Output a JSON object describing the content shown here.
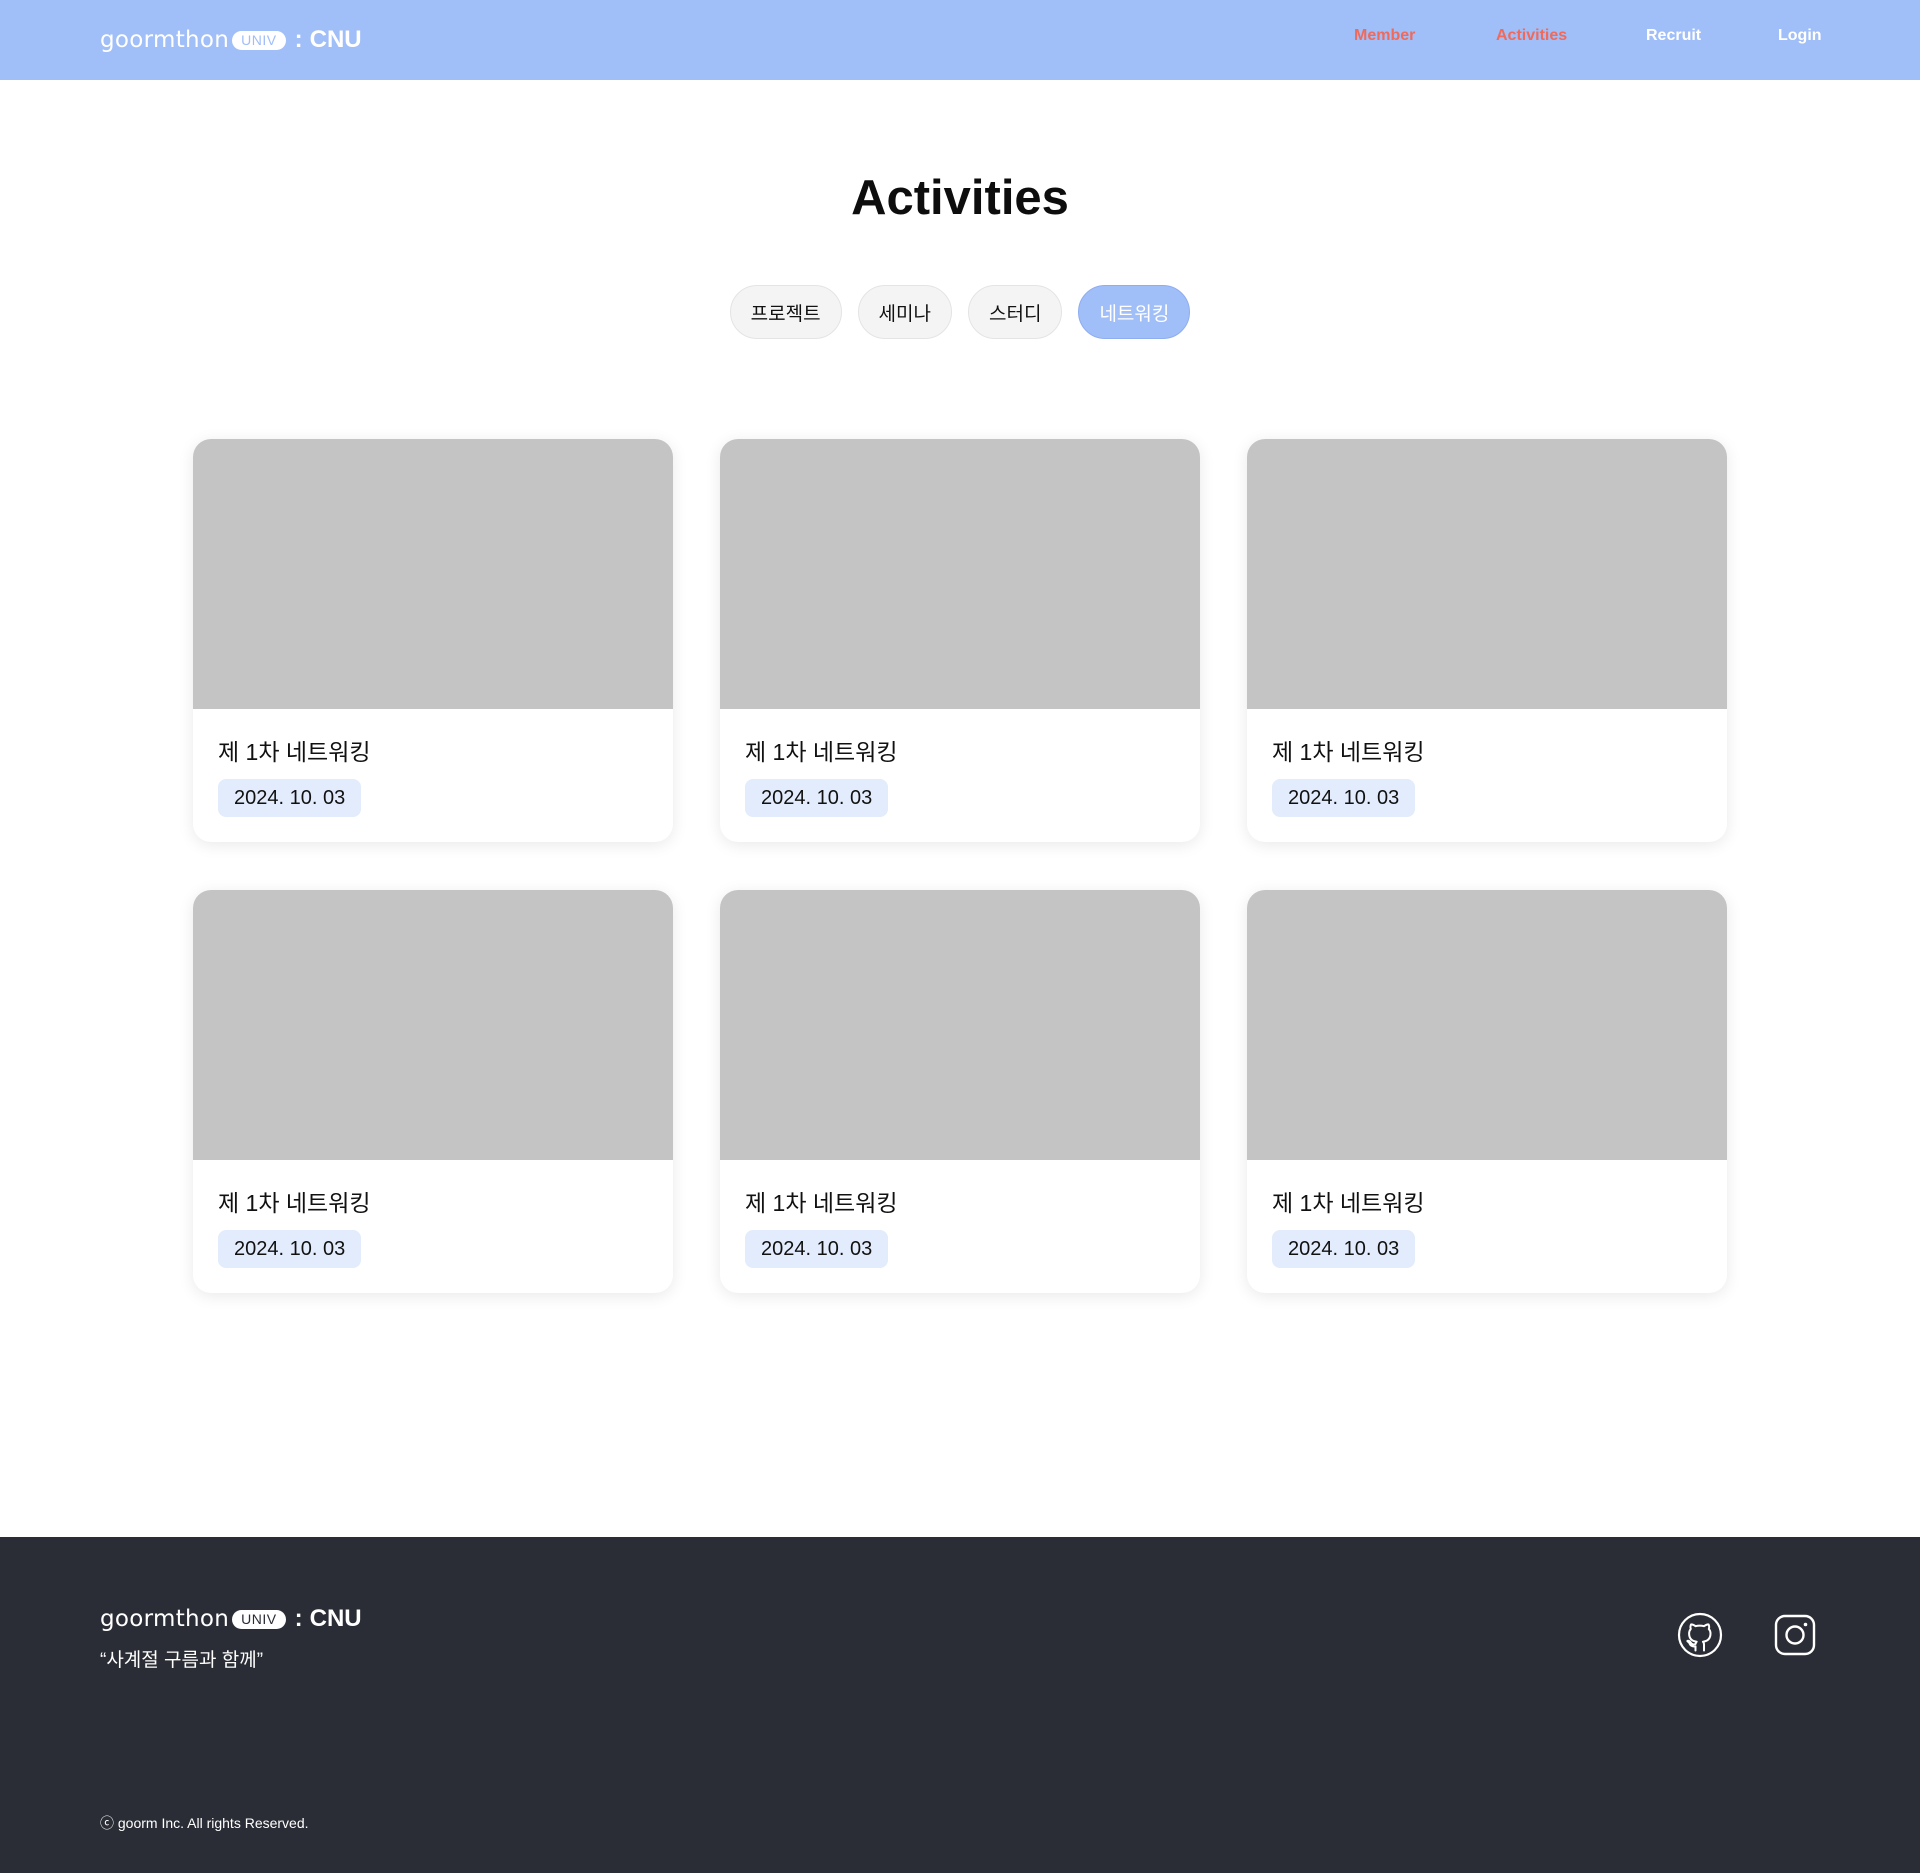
{
  "header": {
    "logo": {
      "wordmark": "goormthon",
      "badge": "UNIV",
      "separator": ":",
      "school": "CNU"
    },
    "nav": [
      {
        "label": "Member",
        "color": "#f06a5c"
      },
      {
        "label": "Activities",
        "color": "#f06a5c"
      },
      {
        "label": "Recruit",
        "color": "#ffffff"
      },
      {
        "label": "Login",
        "color": "#ffffff"
      }
    ],
    "background": "#a0bef7"
  },
  "main": {
    "title": "Activities",
    "filters": [
      {
        "label": "프로젝트",
        "active": false
      },
      {
        "label": "세미나",
        "active": false
      },
      {
        "label": "스터디",
        "active": false
      },
      {
        "label": "네트워킹",
        "active": true
      }
    ],
    "cards": [
      {
        "title": "제 1차 네트워킹",
        "date": "2024. 10. 03"
      },
      {
        "title": "제 1차 네트워킹",
        "date": "2024. 10. 03"
      },
      {
        "title": "제 1차 네트워킹",
        "date": "2024. 10. 03"
      },
      {
        "title": "제 1차 네트워킹",
        "date": "2024. 10. 03"
      },
      {
        "title": "제 1차 네트워킹",
        "date": "2024. 10. 03"
      },
      {
        "title": "제 1차 네트워킹",
        "date": "2024. 10. 03"
      }
    ]
  },
  "footer": {
    "logo": {
      "wordmark": "goormthon",
      "badge": "UNIV",
      "separator": ":",
      "school": "CNU"
    },
    "tagline": "“사계절 구름과 함께”",
    "copyright": "ⓒ goorm Inc. All rights Reserved.",
    "social": [
      {
        "icon": "github-icon"
      },
      {
        "icon": "instagram-icon"
      }
    ],
    "background": "#2a2d35"
  }
}
